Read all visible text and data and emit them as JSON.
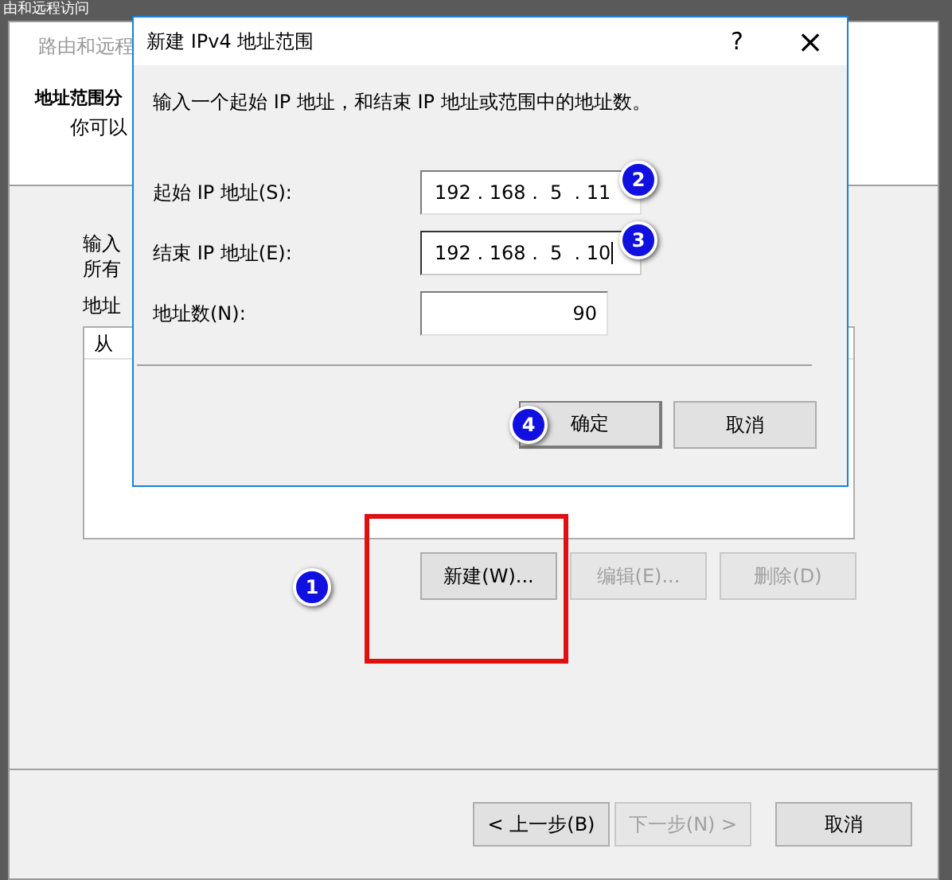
{
  "desktop": {
    "title": "由和远程访问"
  },
  "wizard": {
    "title": "路由和远程",
    "header_title": "地址范围分",
    "header_subtitle": "你可以",
    "body_lines": [
      "输入",
      "所有"
    ],
    "list_label": "地址",
    "list": {
      "columns": [
        "从"
      ]
    },
    "buttons": [
      {
        "label": "新建(W)...",
        "disabled": false,
        "badge": "1",
        "highlighted": true
      },
      {
        "label": "编辑(E)...",
        "disabled": true,
        "highlighted": false
      },
      {
        "label": "删除(D)",
        "disabled": true,
        "highlighted": false
      }
    ],
    "footer_buttons": [
      {
        "label": "< 上一步(B)",
        "disabled": false
      },
      {
        "label": "下一步(N) >",
        "disabled": true
      },
      {
        "label": "取消",
        "disabled": false,
        "kind": "cancel"
      }
    ]
  },
  "dialog": {
    "title": "新建 IPv4 地址范围",
    "help": "?",
    "close": "×",
    "instruction": "输入一个起始 IP 地址，和结束 IP 地址或范围中的地址数。",
    "fields": [
      {
        "kind": "ip",
        "label": "起始 IP 地址(S):",
        "value": "192 . 168 .  5  . 11",
        "focused": false,
        "badge": "2"
      },
      {
        "kind": "ip",
        "label": "结束 IP 地址(E):",
        "value": "192 . 168 .  5  . 10",
        "focused": true,
        "badge": "3"
      },
      {
        "kind": "number",
        "label": "地址数(N):",
        "value": "90",
        "focused": false
      }
    ],
    "buttons": [
      {
        "label": "确定",
        "default": true,
        "badge": "4"
      },
      {
        "label": "取消",
        "default": false
      }
    ]
  }
}
